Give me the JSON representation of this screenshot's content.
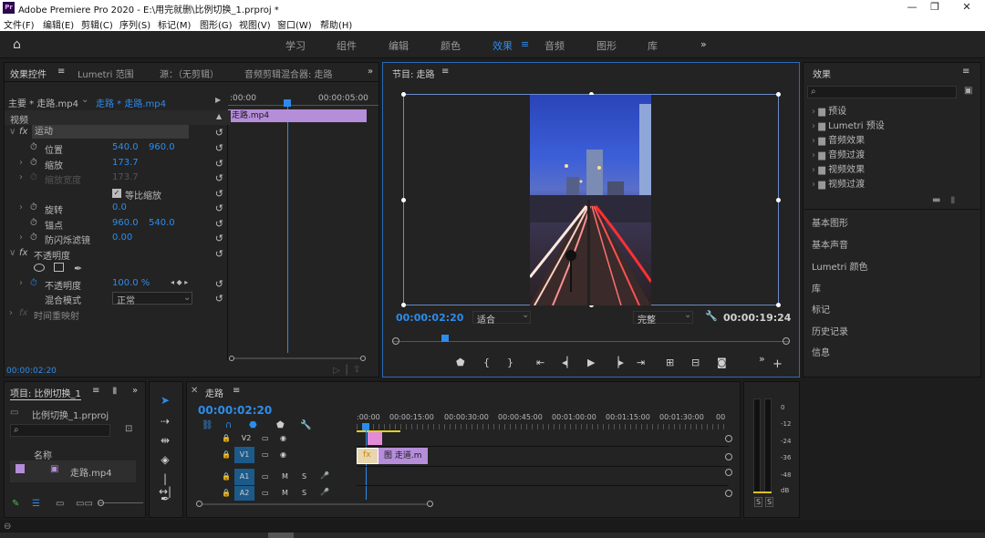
{
  "titlebar": {
    "app": "Adobe Premiere Pro 2020 - E:\\用完就删\\比例切换_1.prproj *",
    "icon": "Pr"
  },
  "menu": [
    "文件(F)",
    "编辑(E)",
    "剪辑(C)",
    "序列(S)",
    "标记(M)",
    "图形(G)",
    "视图(V)",
    "窗口(W)",
    "帮助(H)"
  ],
  "workspaces": [
    {
      "label": "学习"
    },
    {
      "label": "组件"
    },
    {
      "label": "编辑"
    },
    {
      "label": "颜色"
    },
    {
      "label": "效果",
      "active": true
    },
    {
      "label": "音频"
    },
    {
      "label": "图形"
    },
    {
      "label": "库"
    }
  ],
  "ws_more": "»",
  "effect_controls": {
    "tabs": [
      "效果控件",
      "Lumetri 范围",
      "源：（无剪辑）",
      "音频剪辑混合器: 走路"
    ],
    "master": "主要 * 走路.mp4",
    "clip": "走路 * 走路.mp4",
    "ruler_start": ":00:00",
    "ruler_end": "00:00:05:00",
    "clip_label": "走路.mp4",
    "video_header": "视频",
    "motion": "运动",
    "position": {
      "label": "位置",
      "x": "540.0",
      "y": "960.0"
    },
    "scale": {
      "label": "缩放",
      "value": "173.7"
    },
    "scale_width": {
      "label": "缩放宽度",
      "value": "173.7"
    },
    "uniform": "等比缩放",
    "rotation": {
      "label": "旋转",
      "value": "0.0"
    },
    "anchor": {
      "label": "锚点",
      "x": "960.0",
      "y": "540.0"
    },
    "flicker": {
      "label": "防闪烁滤镜",
      "value": "0.00"
    },
    "opacity": "不透明度",
    "opacity_value": {
      "label": "不透明度",
      "value": "100.0 %"
    },
    "blend": {
      "label": "混合模式",
      "value": "正常"
    },
    "time_remap": "时间重映射",
    "timecode": "00:00:02:20"
  },
  "program": {
    "title": "节目: 走路",
    "timecode": "00:00:02:20",
    "fit": "适合",
    "quality": "完整",
    "duration": "00:00:19:24"
  },
  "effects": {
    "title": "效果",
    "items": [
      "预设",
      "Lumetri 预设",
      "音频效果",
      "音频过渡",
      "视频效果",
      "视频过渡"
    ],
    "panels": [
      "基本图形",
      "基本声音",
      "Lumetri 颜色",
      "库",
      "标记",
      "历史记录",
      "信息"
    ]
  },
  "project": {
    "title": "项目: 比例切换_1",
    "file": "比例切换_1.prproj",
    "col_name": "名称",
    "item": "走路.mp4"
  },
  "timeline": {
    "title": "走路",
    "timecode": "00:00:02:20",
    "ruler": [
      ":00:00",
      "00:00:15:00",
      "00:00:30:00",
      "00:00:45:00",
      "00:01:00:00",
      "00:01:15:00",
      "00:01:30:00",
      "00"
    ],
    "tracks": [
      {
        "label": "V2"
      },
      {
        "label": "V1"
      },
      {
        "label": "A1"
      },
      {
        "label": "A2"
      }
    ],
    "v1_clip": "图 走道.m",
    "meter_ticks": [
      "0",
      "-12",
      "-24",
      "-36",
      "-48",
      "dB"
    ],
    "solo": [
      "S",
      "S"
    ],
    "mute": "M",
    "solo_s": "S"
  }
}
